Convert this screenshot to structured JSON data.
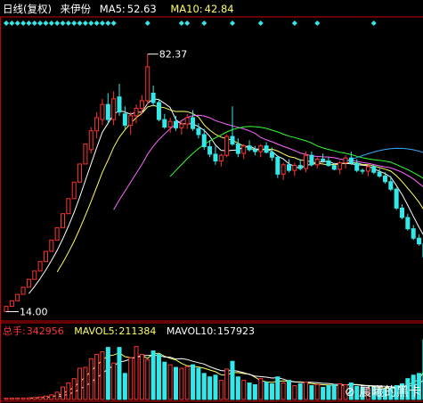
{
  "header": {
    "period_label": "日线(复权)",
    "stock_name": "来伊份",
    "ma5_label": "MA5:",
    "ma5_value": "52.63",
    "ma10_label": "MA10:",
    "ma10_value": "42.84"
  },
  "volume_header": {
    "total_label": "总手:",
    "total_value": "342956",
    "mavol5_label": "MAVOL5:",
    "mavol5_value": "211384",
    "mavol10_label": "MAVOL10:",
    "mavol10_value": "157923"
  },
  "watermark": "晨曦的黑卡",
  "colors": {
    "up": "#ff3333",
    "down": "#33e8e8",
    "ma5": "#ffffff",
    "ma10": "#ffff66",
    "ma20": "#ff66ff",
    "ma30": "#33ff33",
    "ma60": "#33aaff",
    "marker": "#33e8e8",
    "frame": "#c0c0c0",
    "axis_red": "#cc0000"
  },
  "chart_data": {
    "type": "candlestick",
    "annotations": [
      {
        "label": "82.37",
        "kind": "high"
      },
      {
        "label": "14.00",
        "kind": "low"
      }
    ],
    "price_range": [
      12,
      92
    ],
    "candles": [
      [
        14.0,
        15.4,
        14.0,
        15.4
      ],
      [
        15.4,
        16.9,
        15.4,
        16.9
      ],
      [
        16.9,
        18.6,
        16.9,
        18.6
      ],
      [
        18.6,
        20.5,
        18.6,
        20.5
      ],
      [
        20.5,
        22.6,
        20.5,
        22.6
      ],
      [
        22.6,
        24.8,
        22.6,
        24.8
      ],
      [
        24.8,
        27.3,
        24.8,
        27.3
      ],
      [
        27.3,
        30.0,
        27.3,
        30.0
      ],
      [
        30.0,
        33.0,
        30.0,
        33.0
      ],
      [
        33.0,
        36.3,
        33.0,
        36.3
      ],
      [
        36.3,
        40.0,
        36.3,
        40.0
      ],
      [
        40.0,
        44.0,
        40.0,
        44.0
      ],
      [
        44.0,
        48.4,
        44.0,
        48.4
      ],
      [
        48.4,
        53.2,
        48.4,
        53.2
      ],
      [
        53.2,
        58.5,
        53.2,
        58.5
      ],
      [
        57.0,
        63.0,
        56.0,
        62.0
      ],
      [
        62.0,
        67.0,
        60.0,
        65.5
      ],
      [
        65.0,
        70.5,
        63.5,
        69.0
      ],
      [
        69.0,
        72.0,
        64.0,
        65.0
      ],
      [
        65.0,
        72.5,
        63.5,
        70.5
      ],
      [
        71.0,
        74.5,
        66.0,
        67.0
      ],
      [
        66.5,
        68.5,
        62.5,
        63.5
      ],
      [
        63.5,
        67.0,
        61.0,
        66.0
      ],
      [
        66.0,
        69.0,
        64.0,
        68.0
      ],
      [
        68.0,
        71.5,
        66.5,
        70.0
      ],
      [
        70.0,
        82.37,
        69.0,
        79.0
      ],
      [
        72.0,
        74.0,
        68.5,
        69.5
      ],
      [
        69.5,
        70.5,
        64.5,
        65.0
      ],
      [
        65.0,
        66.5,
        62.5,
        63.0
      ],
      [
        63.0,
        65.5,
        61.5,
        64.5
      ],
      [
        64.5,
        66.0,
        62.0,
        62.8
      ],
      [
        62.8,
        64.5,
        61.0,
        63.8
      ],
      [
        63.8,
        66.5,
        62.5,
        65.5
      ],
      [
        65.5,
        67.5,
        62.0,
        62.6
      ],
      [
        62.6,
        64.0,
        60.0,
        61.0
      ],
      [
        61.0,
        62.5,
        57.0,
        57.8
      ],
      [
        57.8,
        59.5,
        55.0,
        55.8
      ],
      [
        55.8,
        58.0,
        53.0,
        54.0
      ],
      [
        54.0,
        56.0,
        52.5,
        55.5
      ],
      [
        55.5,
        61.0,
        55.0,
        60.5
      ],
      [
        60.5,
        68.5,
        58.0,
        58.5
      ],
      [
        58.5,
        60.0,
        55.0,
        56.0
      ],
      [
        56.0,
        58.5,
        54.5,
        58.0
      ],
      [
        58.0,
        59.5,
        56.5,
        57.0
      ],
      [
        57.0,
        58.0,
        55.5,
        56.5
      ],
      [
        56.5,
        58.5,
        55.0,
        58.0
      ],
      [
        58.0,
        59.0,
        56.0,
        56.3
      ],
      [
        56.3,
        57.5,
        54.0,
        55.0
      ],
      [
        55.0,
        55.5,
        49.5,
        50.5
      ],
      [
        50.5,
        53.5,
        49.0,
        53.0
      ],
      [
        53.0,
        54.5,
        51.0,
        51.5
      ],
      [
        51.5,
        53.5,
        50.0,
        52.8
      ],
      [
        52.8,
        54.5,
        51.5,
        52.0
      ],
      [
        52.0,
        56.5,
        51.0,
        55.5
      ],
      [
        55.5,
        56.5,
        52.5,
        53.0
      ],
      [
        53.0,
        55.0,
        52.0,
        54.5
      ],
      [
        54.5,
        56.0,
        53.5,
        54.0
      ],
      [
        54.0,
        55.0,
        52.5,
        52.8
      ],
      [
        52.8,
        53.5,
        51.5,
        51.8
      ],
      [
        51.8,
        54.0,
        50.5,
        53.5
      ],
      [
        53.5,
        55.5,
        52.0,
        54.8
      ],
      [
        54.8,
        56.5,
        53.0,
        53.4
      ],
      [
        53.4,
        54.5,
        51.0,
        51.5
      ],
      [
        51.5,
        52.0,
        50.5,
        51.3
      ],
      [
        51.3,
        53.0,
        50.0,
        52.5
      ],
      [
        52.5,
        53.0,
        50.5,
        51.0
      ],
      [
        51.0,
        52.0,
        49.5,
        50.0
      ],
      [
        50.0,
        51.0,
        48.0,
        48.5
      ],
      [
        48.5,
        50.0,
        46.0,
        46.5
      ],
      [
        46.5,
        47.0,
        41.0,
        41.5
      ],
      [
        41.5,
        42.5,
        38.5,
        39.0
      ],
      [
        39.0,
        40.0,
        35.5,
        36.0
      ],
      [
        36.0,
        37.0,
        33.0,
        33.5
      ],
      [
        33.5,
        34.5,
        31.5,
        32.0
      ],
      [
        32.0,
        33.5,
        27.5,
        28.5
      ]
    ],
    "volumes": [
      7000,
      7500,
      8000,
      8500,
      9000,
      11000,
      14000,
      19000,
      26000,
      42000,
      72000,
      95000,
      120000,
      180000,
      185000,
      235000,
      260000,
      275000,
      300000,
      210000,
      300000,
      150000,
      240000,
      305000,
      260000,
      230000,
      280000,
      260000,
      215000,
      200000,
      185000,
      180000,
      190000,
      200000,
      180000,
      150000,
      130000,
      140000,
      110000,
      175000,
      220000,
      130000,
      110000,
      95000,
      85000,
      120000,
      100000,
      90000,
      130000,
      95000,
      110000,
      80000,
      90000,
      100000,
      80000,
      85000,
      70000,
      80000,
      85000,
      90000,
      85000,
      95000,
      75000,
      70000,
      65000,
      70000,
      60000,
      60000,
      65000,
      80000,
      90000,
      120000,
      140000,
      150000,
      342956
    ],
    "series": [
      {
        "name": "MA5",
        "key": "ma5"
      },
      {
        "name": "MA10",
        "key": "ma10"
      }
    ]
  }
}
